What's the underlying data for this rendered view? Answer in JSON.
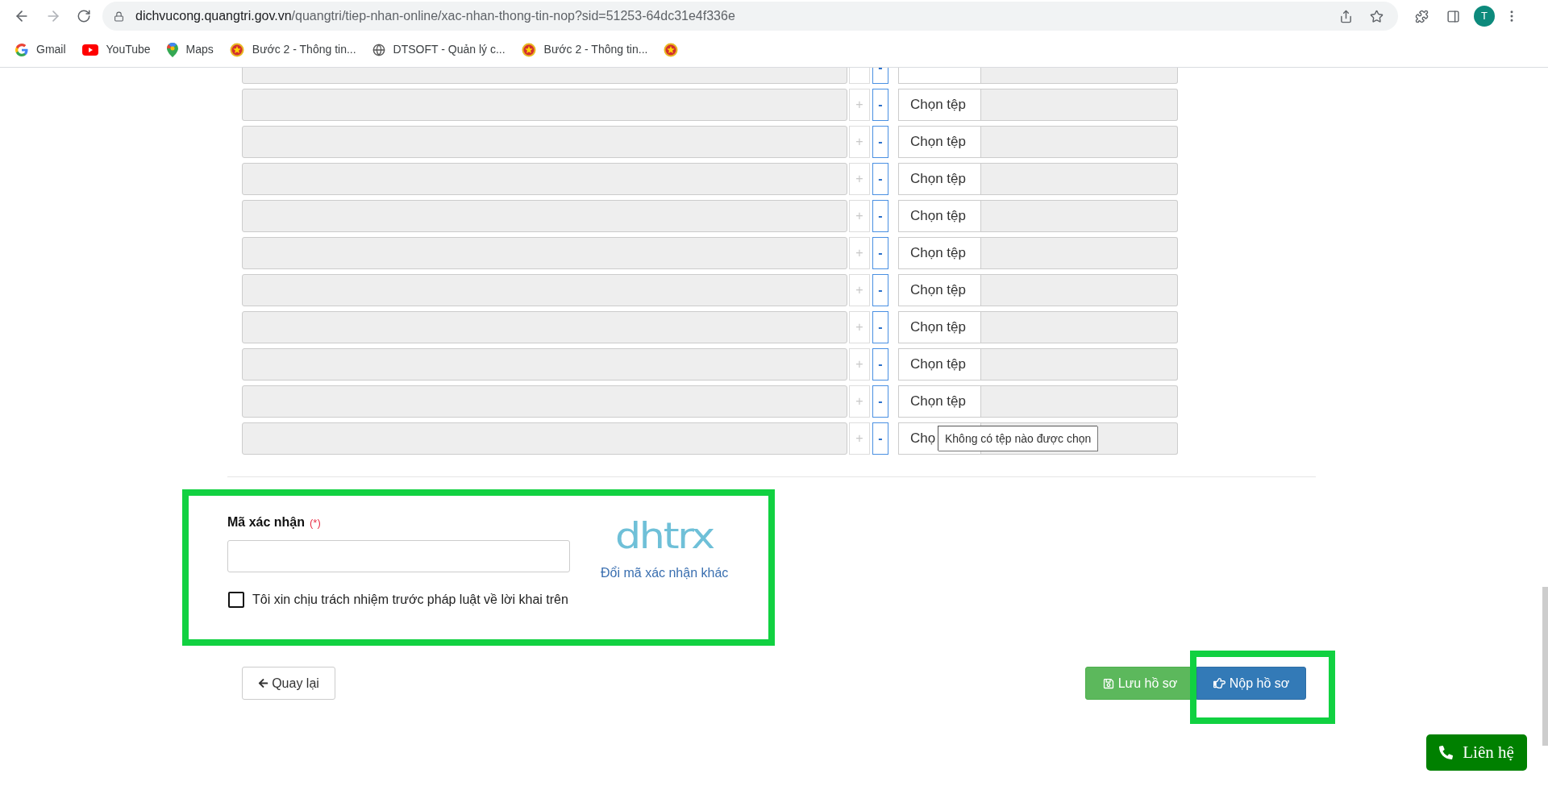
{
  "browser": {
    "url_host": "dichvucong.quangtri.gov.vn",
    "url_path": "/quangtri/tiep-nhan-online/xac-nhan-thong-tin-nop?sid=51253-64dc31e4f336e",
    "avatar": "T",
    "bookmarks": [
      {
        "kind": "gmail",
        "label": "Gmail"
      },
      {
        "kind": "youtube",
        "label": "YouTube"
      },
      {
        "kind": "maps",
        "label": "Maps"
      },
      {
        "kind": "emblem",
        "label": "Bước 2 - Thông tin..."
      },
      {
        "kind": "globe",
        "label": "DTSOFT - Quản lý c..."
      },
      {
        "kind": "emblem",
        "label": "Bước 2 - Thông tin..."
      },
      {
        "kind": "emblem"
      }
    ]
  },
  "file_rows": [
    {
      "minus": "-"
    },
    {
      "plus": "+",
      "minus": "-",
      "button": "Chọn tệp"
    },
    {
      "plus": "+",
      "minus": "-",
      "button": "Chọn tệp"
    },
    {
      "plus": "+",
      "minus": "-",
      "button": "Chọn tệp"
    },
    {
      "plus": "+",
      "minus": "-",
      "button": "Chọn tệp"
    },
    {
      "plus": "+",
      "minus": "-",
      "button": "Chọn tệp"
    },
    {
      "plus": "+",
      "minus": "-",
      "button": "Chọn tệp"
    },
    {
      "plus": "+",
      "minus": "-",
      "button": "Chọn tệp"
    },
    {
      "plus": "+",
      "minus": "-",
      "button": "Chọn tệp"
    },
    {
      "plus": "+",
      "minus": "-",
      "button": "Chọn tệp"
    },
    {
      "plus": "+",
      "minus": "-",
      "button": "Chọ"
    }
  ],
  "file_tooltip": "Không có tệp nào được chọn",
  "captcha": {
    "label": "Mã xác nhận",
    "required": "(*)",
    "code": "dhtrx",
    "refresh_link": "Đổi mã xác nhận khác"
  },
  "agreement": {
    "label": "Tôi xin chịu trách nhiệm trước pháp luật về lời khai trên",
    "checked": false
  },
  "actions": {
    "back": "Quay lại",
    "save": "Lưu hồ sơ",
    "submit": "Nộp hồ sơ"
  },
  "contact": "Liên hệ"
}
